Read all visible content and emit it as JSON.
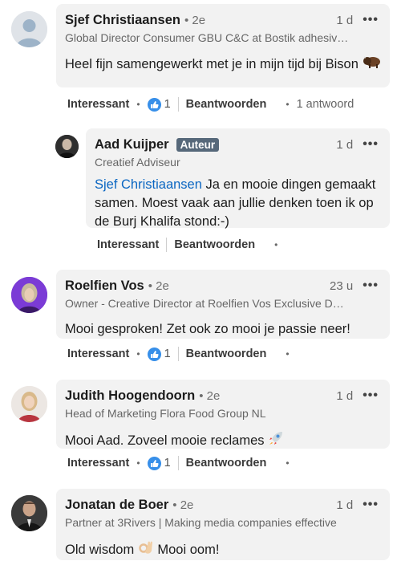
{
  "comments": [
    {
      "name": "Sjef Christiaansen",
      "degree": "• 2e",
      "time": "1 d",
      "headline": "Global Director Consumer GBU C&C at Bostik adhesiv…",
      "text": "Heel fijn samengewerkt met je in mijn tijd bij Bison",
      "emoji": "bison-emoji",
      "actions": {
        "like": "Interessant",
        "reply": "Beantwoorden",
        "reaction_count": "1",
        "replies": "1 antwoord"
      }
    },
    {
      "name": "Aad Kuijper",
      "badge": "Auteur",
      "time": "1 d",
      "headline": "Creatief Adviseur",
      "mention": "Sjef Christiaansen",
      "text": " Ja en mooie dingen gemaakt samen. Moest vaak aan jullie denken toen ik op de Burj Khalifa stond:-)",
      "actions": {
        "like": "Interessant",
        "reply": "Beantwoorden"
      }
    },
    {
      "name": "Roelfien Vos",
      "degree": "• 2e",
      "time": "23 u",
      "headline": "Owner - Creative Director at Roelfien Vos Exclusive D…",
      "text": "Mooi gesproken! Zet ook zo mooi je passie neer!",
      "actions": {
        "like": "Interessant",
        "reply": "Beantwoorden",
        "reaction_count": "1"
      }
    },
    {
      "name": "Judith Hoogendoorn",
      "degree": "• 2e",
      "time": "1 d",
      "headline": "Head of Marketing Flora Food Group NL",
      "text": "Mooi Aad. Zoveel mooie reclames",
      "emoji": "rocket-emoji",
      "actions": {
        "like": "Interessant",
        "reply": "Beantwoorden",
        "reaction_count": "1"
      }
    },
    {
      "name": "Jonatan de Boer",
      "degree": "• 2e",
      "time": "1 d",
      "headline": "Partner at 3Rivers | Making media companies effective",
      "text_before": "Old wisdom",
      "emoji": "ok-hand-emoji",
      "text_after": " Mooi oom!"
    }
  ],
  "more_glyph": "•••",
  "dot_glyph": "•",
  "colors": {
    "link": "#0a66c2",
    "bubble": "#f2f2f2",
    "like_blue": "#378fe9",
    "badge": "#56687a"
  }
}
